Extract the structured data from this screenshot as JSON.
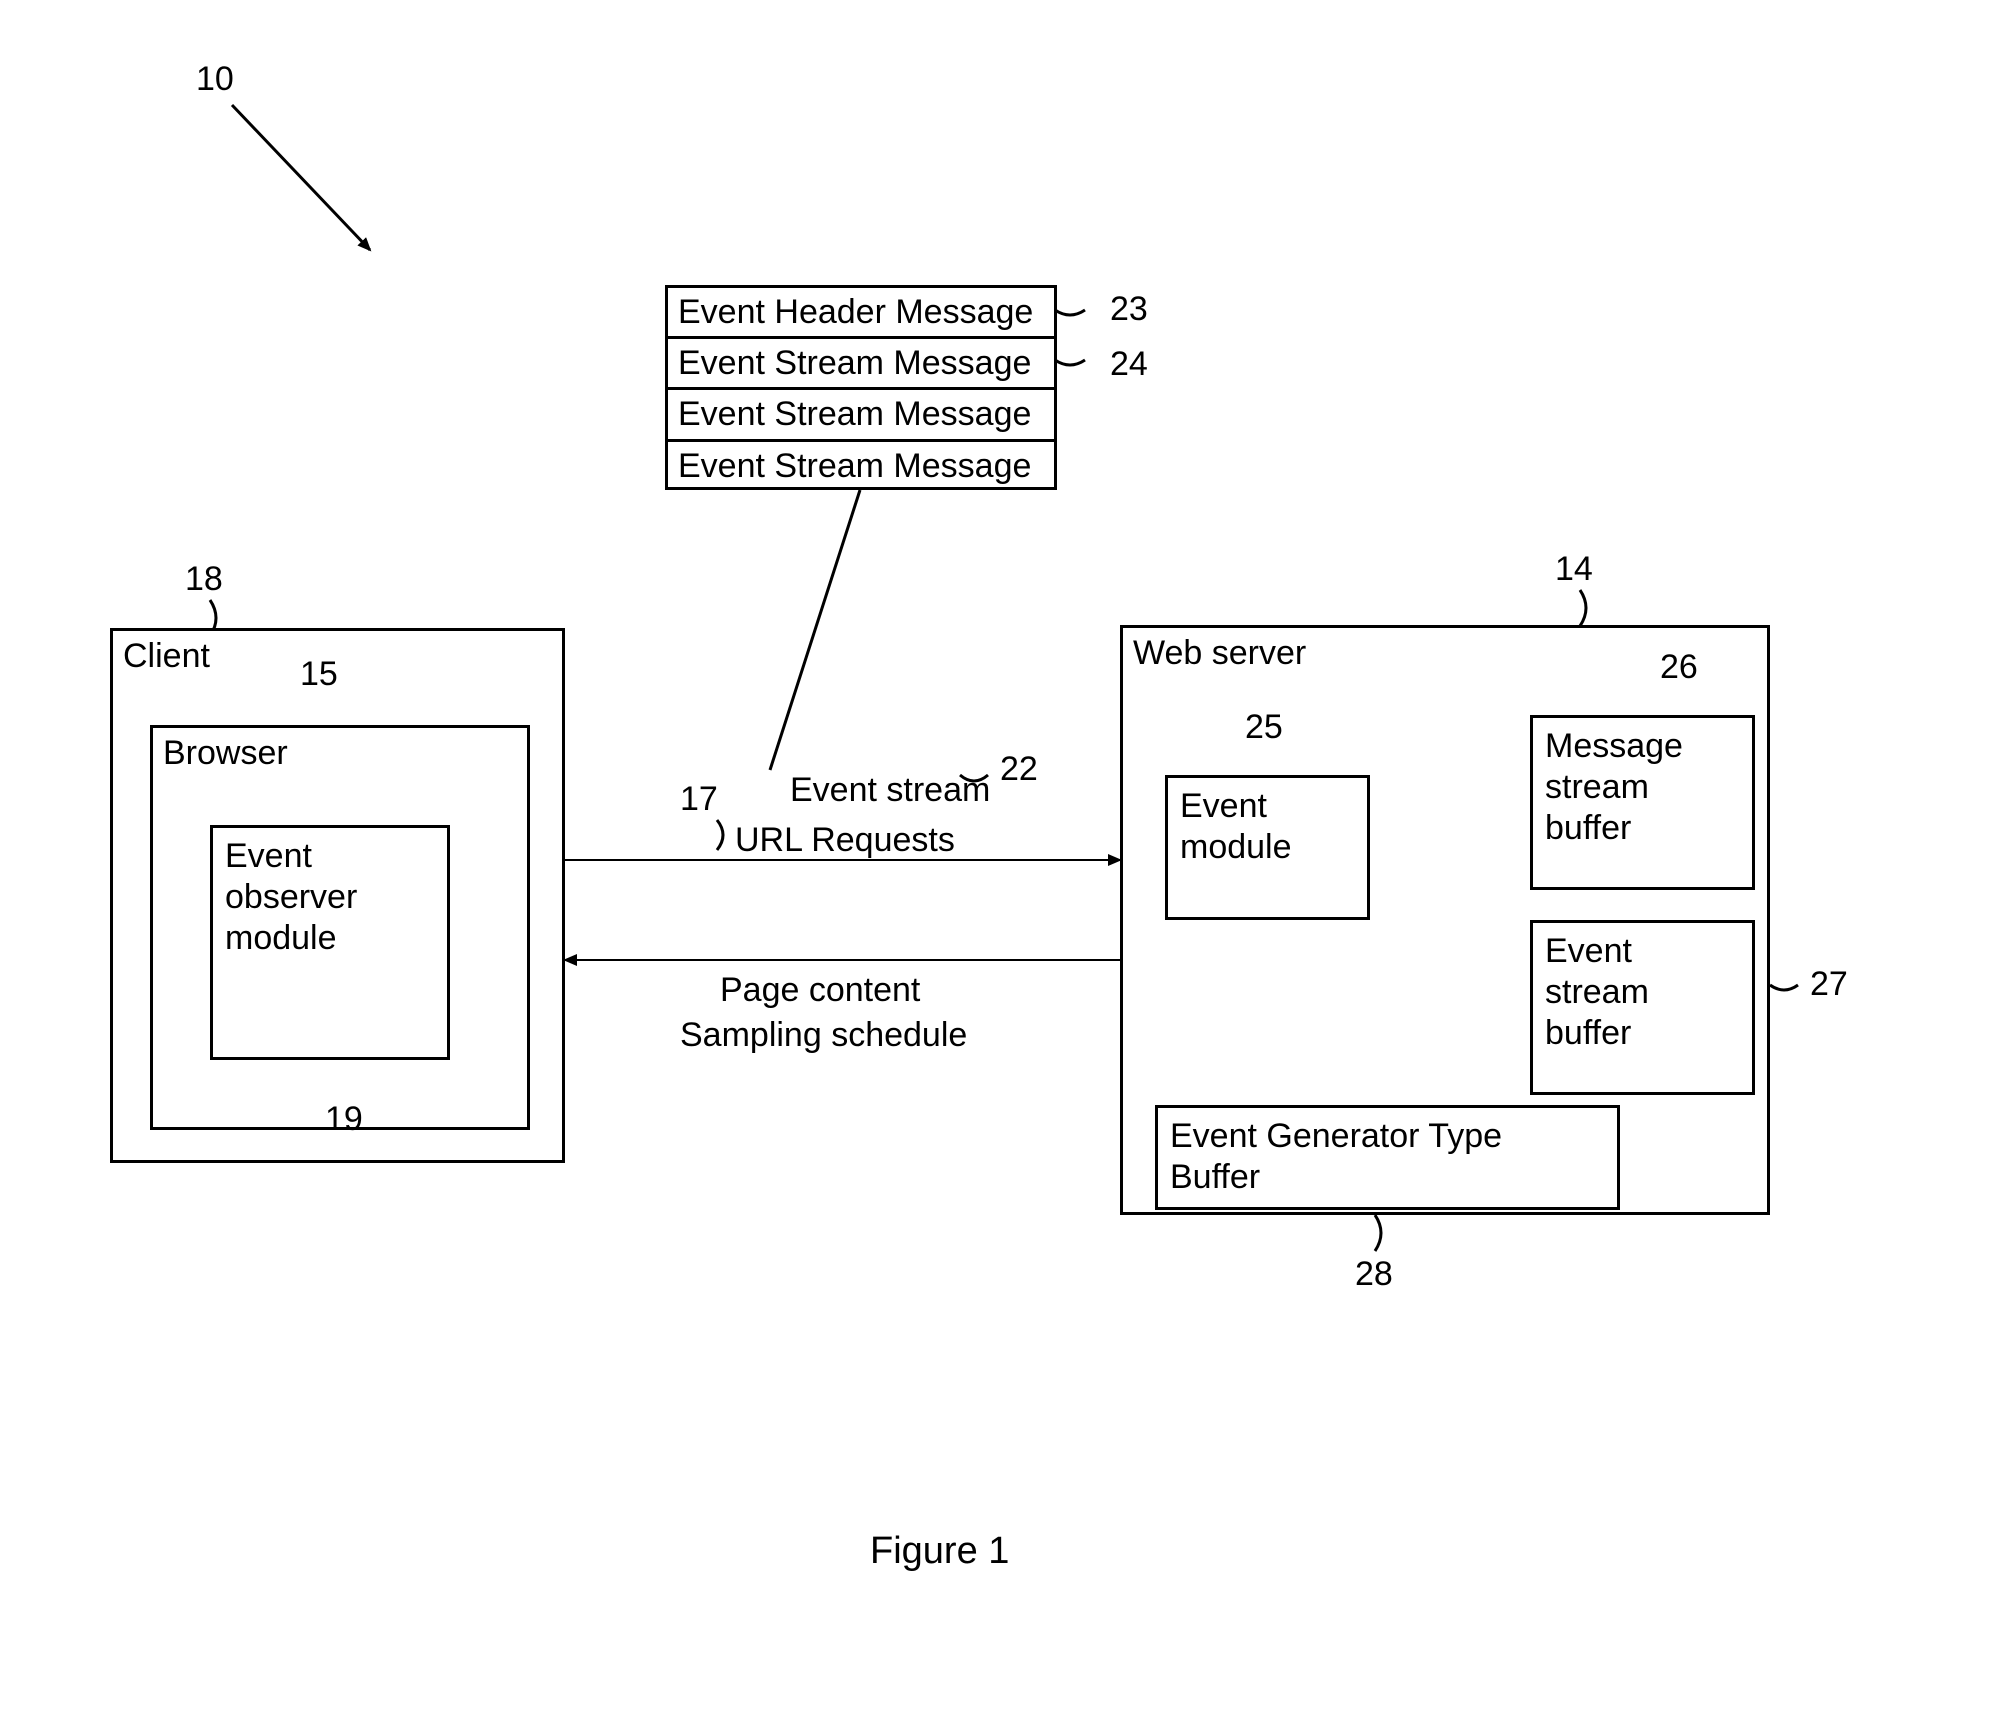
{
  "figure": {
    "caption": "Figure 1"
  },
  "refs": {
    "r10": "10",
    "r14": "14",
    "r15": "15",
    "r17": "17",
    "r18": "18",
    "r19": "19",
    "r22": "22",
    "r23": "23",
    "r24": "24",
    "r25": "25",
    "r26": "26",
    "r27": "27",
    "r28": "28"
  },
  "client": {
    "title": "Client",
    "browser": {
      "title": "Browser",
      "observer": "Event observer module"
    }
  },
  "server": {
    "title": "Web server",
    "event_module": "Event module",
    "msg_buffer": "Message stream buffer",
    "event_buffer": "Event stream buffer",
    "gen_buffer": "Event Generator Type Buffer"
  },
  "stack": {
    "row1": "Event Header Message",
    "row2": "Event Stream Message",
    "row3": "Event Stream Message",
    "row4": "Event Stream Message"
  },
  "arrows": {
    "top": {
      "url": "URL Requests",
      "stream": "Event stream"
    },
    "bottom": {
      "page": "Page content",
      "sched": "Sampling schedule"
    }
  }
}
